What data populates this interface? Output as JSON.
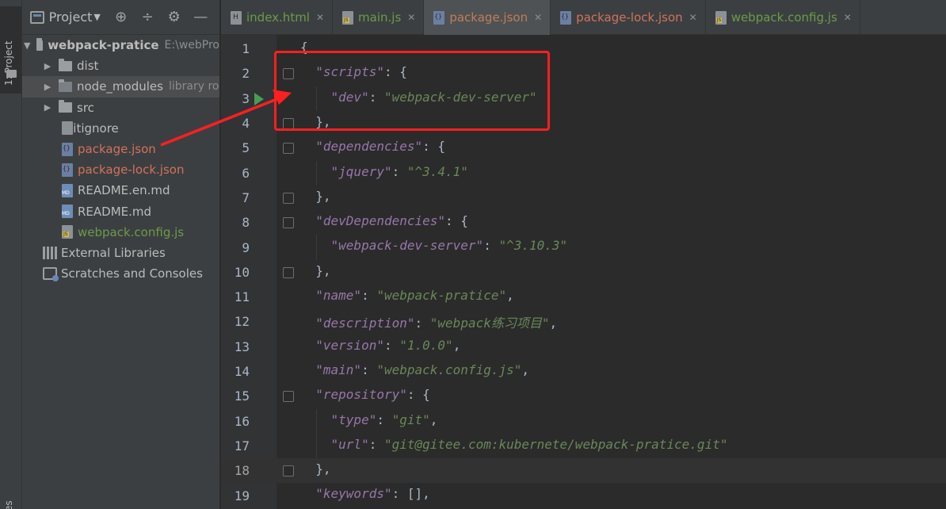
{
  "toolstrip": {
    "project_tab": "1: Project",
    "bottom_tab": "es"
  },
  "panel": {
    "title": "Project",
    "items": [
      {
        "label": "webpack-pratice",
        "hint": "E:\\webPro"
      },
      {
        "label": "dist"
      },
      {
        "label": "node_modules",
        "hint": "library ro"
      },
      {
        "label": "src"
      },
      {
        "label": ".gitignore"
      },
      {
        "label": "package.json"
      },
      {
        "label": "package-lock.json"
      },
      {
        "label": "README.en.md"
      },
      {
        "label": "README.md"
      },
      {
        "label": "webpack.config.js"
      },
      {
        "label": "External Libraries"
      },
      {
        "label": "Scratches and Consoles"
      }
    ]
  },
  "tabs": [
    {
      "label": "index.html"
    },
    {
      "label": "main.js"
    },
    {
      "label": "package.json"
    },
    {
      "label": "package-lock.json"
    },
    {
      "label": "webpack.config.js"
    }
  ],
  "code": {
    "line_numbers": [
      "1",
      "2",
      "3",
      "4",
      "5",
      "6",
      "7",
      "8",
      "9",
      "10",
      "11",
      "12",
      "13",
      "14",
      "15",
      "16",
      "17",
      "18",
      "19"
    ],
    "lines": [
      "{",
      "  \"scripts\": {",
      "    \"dev\": \"webpack-dev-server\"",
      "  },",
      "  \"dependencies\": {",
      "    \"jquery\": \"^3.4.1\"",
      "  },",
      "  \"devDependencies\": {",
      "    \"webpack-dev-server\": \"^3.10.3\"",
      "  },",
      "  \"name\": \"webpack-pratice\",",
      "  \"description\": \"webpack练习项目\",",
      "  \"version\": \"1.0.0\",",
      "  \"main\": \"webpack.config.js\",",
      "  \"repository\": {",
      "    \"type\": \"git\",",
      "    \"url\": \"git@gitee.com:kubernete/webpack-pratice.git\"",
      "  },",
      "  \"keywords\": [],"
    ]
  },
  "colors": {
    "accent_red": "#ff1f1f",
    "run_green": "#499c54"
  }
}
